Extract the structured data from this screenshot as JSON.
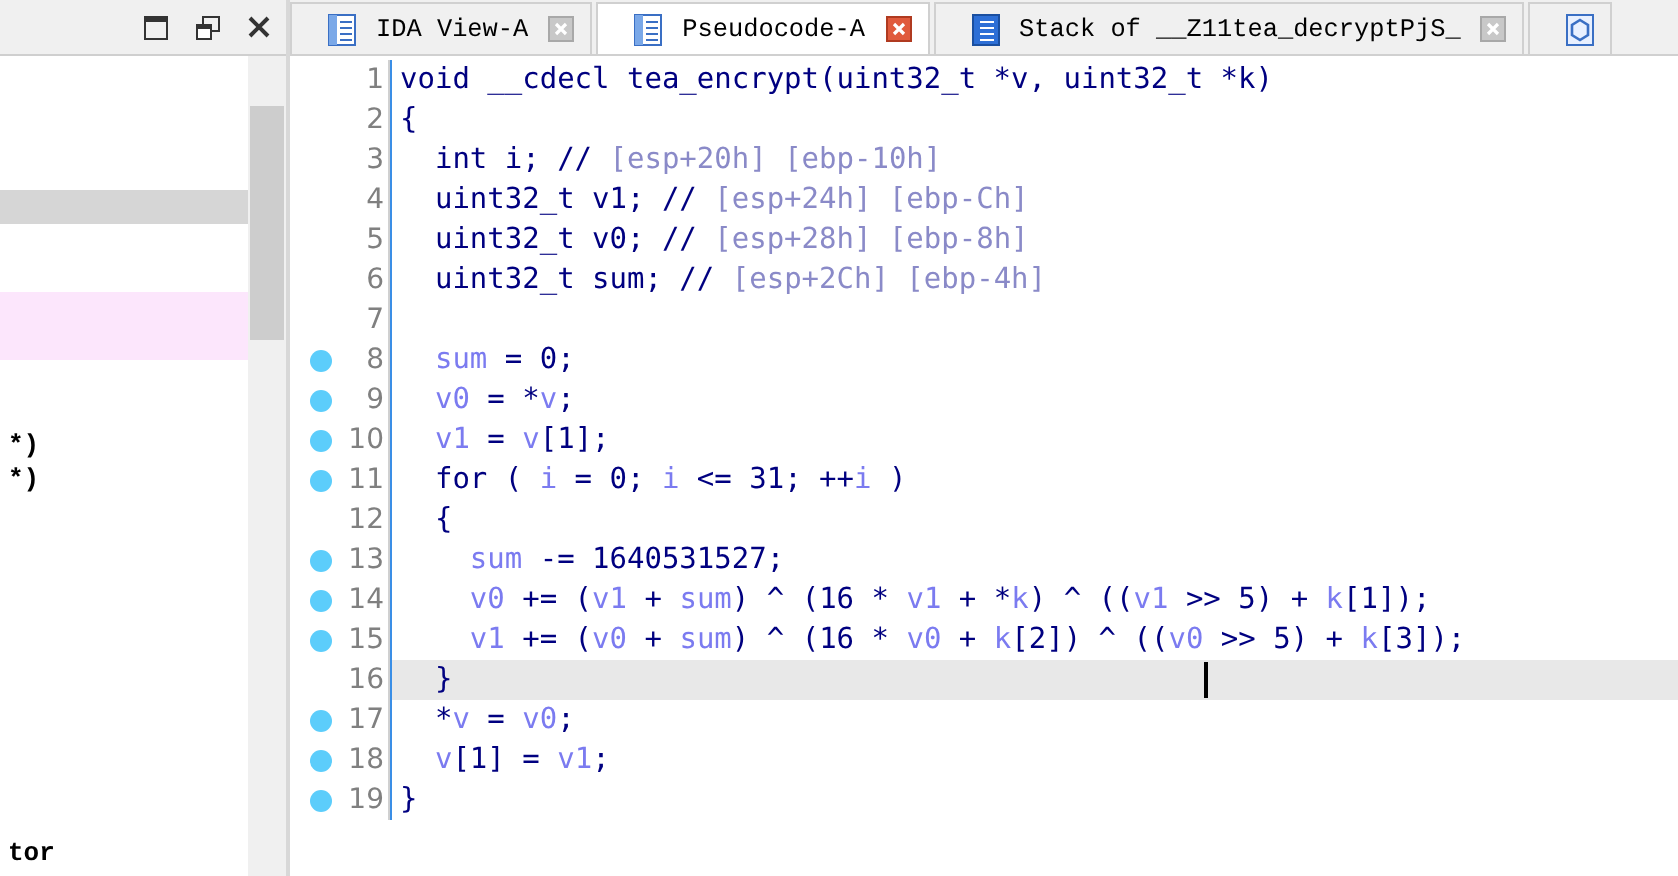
{
  "left_panel": {
    "rows": [
      {
        "selected": false,
        "marked": false
      },
      {
        "selected": false,
        "marked": false
      },
      {
        "selected": false,
        "marked": false
      },
      {
        "selected": true,
        "marked": false
      },
      {
        "selected": false,
        "marked": false
      },
      {
        "selected": false,
        "marked": false
      },
      {
        "selected": false,
        "marked": true
      },
      {
        "selected": false,
        "marked": true
      },
      {
        "selected": false,
        "marked": false
      },
      {
        "selected": false,
        "marked": false
      },
      {
        "selected": false,
        "marked": false,
        "text": "*)"
      },
      {
        "selected": false,
        "marked": false,
        "text": "*)"
      },
      {
        "selected": false,
        "marked": false
      },
      {
        "selected": false,
        "marked": false
      },
      {
        "selected": false,
        "marked": false
      },
      {
        "selected": false,
        "marked": false
      },
      {
        "selected": false,
        "marked": false
      },
      {
        "selected": false,
        "marked": false
      },
      {
        "selected": false,
        "marked": false
      },
      {
        "selected": false,
        "marked": false
      },
      {
        "selected": false,
        "marked": false
      },
      {
        "selected": false,
        "marked": false
      },
      {
        "selected": false,
        "marked": false,
        "text": "tor"
      }
    ]
  },
  "tabs": [
    {
      "label": "IDA View-A",
      "selected": false,
      "kind": "listing"
    },
    {
      "label": "Pseudocode-A",
      "selected": true,
      "kind": "listing"
    },
    {
      "label": "Stack of __Z11tea_decryptPjS_",
      "selected": false,
      "kind": "stack"
    },
    {
      "selected": false,
      "kind": "structure"
    }
  ],
  "code": {
    "lines": [
      {
        "number": "1",
        "breakpoint": false,
        "current": false,
        "segments": [
          {
            "kind": "code",
            "text": "void __cdecl tea_encrypt(uint32_t *v, uint32_t *k)"
          }
        ]
      },
      {
        "number": "2",
        "breakpoint": false,
        "current": false,
        "segments": [
          {
            "kind": "code",
            "text": "{"
          }
        ]
      },
      {
        "number": "3",
        "breakpoint": false,
        "current": false,
        "segments": [
          {
            "kind": "code",
            "text": "  int i; // "
          },
          {
            "kind": "comment",
            "text": "[esp+20h] [ebp-10h]"
          }
        ]
      },
      {
        "number": "4",
        "breakpoint": false,
        "current": false,
        "segments": [
          {
            "kind": "code",
            "text": "  uint32_t v1; // "
          },
          {
            "kind": "comment",
            "text": "[esp+24h] [ebp-Ch]"
          }
        ]
      },
      {
        "number": "5",
        "breakpoint": false,
        "current": false,
        "segments": [
          {
            "kind": "code",
            "text": "  uint32_t v0; // "
          },
          {
            "kind": "comment",
            "text": "[esp+28h] [ebp-8h]"
          }
        ]
      },
      {
        "number": "6",
        "breakpoint": false,
        "current": false,
        "segments": [
          {
            "kind": "code",
            "text": "  uint32_t sum; // "
          },
          {
            "kind": "comment",
            "text": "[esp+2Ch] [ebp-4h]"
          }
        ]
      },
      {
        "number": "7",
        "breakpoint": false,
        "current": false
      },
      {
        "number": "8",
        "breakpoint": true,
        "current": false,
        "segments": [
          {
            "kind": "var",
            "text": "  sum"
          },
          {
            "kind": "code",
            "text": " = 0;"
          }
        ]
      },
      {
        "number": "9",
        "breakpoint": true,
        "current": false,
        "segments": [
          {
            "kind": "var",
            "text": "  v0"
          },
          {
            "kind": "code",
            "text": " = *"
          },
          {
            "kind": "var",
            "text": "v"
          },
          {
            "kind": "code",
            "text": ";"
          }
        ]
      },
      {
        "number": "10",
        "breakpoint": true,
        "current": false,
        "segments": [
          {
            "kind": "var",
            "text": "  v1"
          },
          {
            "kind": "code",
            "text": " = "
          },
          {
            "kind": "var",
            "text": "v"
          },
          {
            "kind": "code",
            "text": "[1];"
          }
        ]
      },
      {
        "number": "11",
        "breakpoint": true,
        "current": false,
        "segments": [
          {
            "kind": "code",
            "text": "  for ( "
          },
          {
            "kind": "var",
            "text": "i"
          },
          {
            "kind": "code",
            "text": " = 0; "
          },
          {
            "kind": "var",
            "text": "i"
          },
          {
            "kind": "code",
            "text": " <= 31; ++"
          },
          {
            "kind": "var",
            "text": "i"
          },
          {
            "kind": "code",
            "text": " )"
          }
        ]
      },
      {
        "number": "12",
        "breakpoint": false,
        "current": false,
        "segments": [
          {
            "kind": "code",
            "text": "  {"
          }
        ]
      },
      {
        "number": "13",
        "breakpoint": true,
        "current": false,
        "segments": [
          {
            "kind": "var",
            "text": "    sum"
          },
          {
            "kind": "code",
            "text": " -= 1640531527;"
          }
        ]
      },
      {
        "number": "14",
        "breakpoint": true,
        "current": false,
        "segments": [
          {
            "kind": "var",
            "text": "    v0"
          },
          {
            "kind": "code",
            "text": " += ("
          },
          {
            "kind": "var",
            "text": "v1"
          },
          {
            "kind": "code",
            "text": " + "
          },
          {
            "kind": "var",
            "text": "sum"
          },
          {
            "kind": "code",
            "text": ") ^ (16 * "
          },
          {
            "kind": "var",
            "text": "v1"
          },
          {
            "kind": "code",
            "text": " + *"
          },
          {
            "kind": "var",
            "text": "k"
          },
          {
            "kind": "code",
            "text": ") ^ (("
          },
          {
            "kind": "var",
            "text": "v1"
          },
          {
            "kind": "code",
            "text": " >> 5) + "
          },
          {
            "kind": "var",
            "text": "k"
          },
          {
            "kind": "code",
            "text": "[1]);"
          }
        ]
      },
      {
        "number": "15",
        "breakpoint": true,
        "current": false,
        "segments": [
          {
            "kind": "var",
            "text": "    v1"
          },
          {
            "kind": "code",
            "text": " += ("
          },
          {
            "kind": "var",
            "text": "v0"
          },
          {
            "kind": "code",
            "text": " + "
          },
          {
            "kind": "var",
            "text": "sum"
          },
          {
            "kind": "code",
            "text": ") ^ (16 * "
          },
          {
            "kind": "var",
            "text": "v0"
          },
          {
            "kind": "code",
            "text": " + "
          },
          {
            "kind": "var",
            "text": "k"
          },
          {
            "kind": "code",
            "text": "[2]) ^ (("
          },
          {
            "kind": "var",
            "text": "v0"
          },
          {
            "kind": "code",
            "text": " >> 5) + "
          },
          {
            "kind": "var",
            "text": "k"
          },
          {
            "kind": "code",
            "text": "[3]);"
          }
        ]
      },
      {
        "number": "16",
        "breakpoint": false,
        "current": true,
        "segments": [
          {
            "kind": "code",
            "text": "  }"
          }
        ]
      },
      {
        "number": "17",
        "breakpoint": true,
        "current": false,
        "segments": [
          {
            "kind": "code",
            "text": "  *"
          },
          {
            "kind": "var",
            "text": "v"
          },
          {
            "kind": "code",
            "text": " = "
          },
          {
            "kind": "var",
            "text": "v0"
          },
          {
            "kind": "code",
            "text": ";"
          }
        ]
      },
      {
        "number": "18",
        "breakpoint": true,
        "current": false,
        "segments": [
          {
            "kind": "var",
            "text": "  v"
          },
          {
            "kind": "code",
            "text": "[1] = "
          },
          {
            "kind": "var",
            "text": "v1"
          },
          {
            "kind": "code",
            "text": ";"
          }
        ]
      },
      {
        "number": "19",
        "breakpoint": true,
        "current": false,
        "segments": [
          {
            "kind": "code",
            "text": "}"
          }
        ]
      }
    ]
  }
}
